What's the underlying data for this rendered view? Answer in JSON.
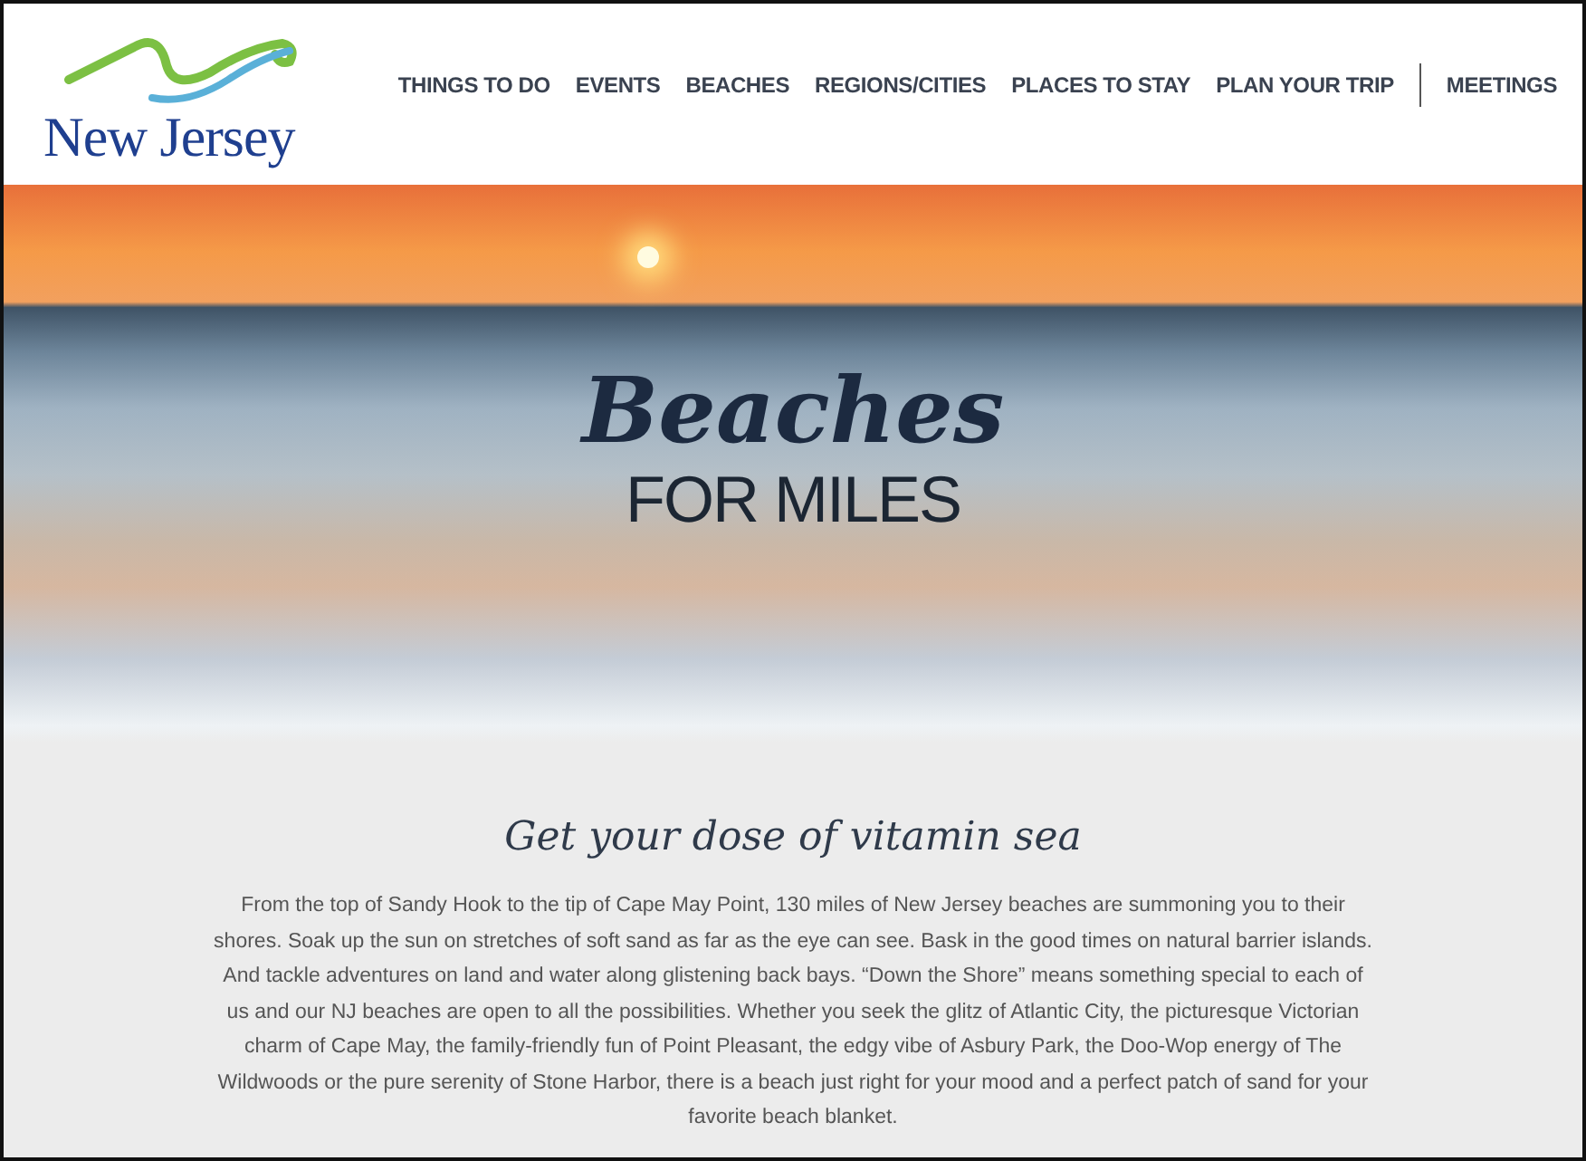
{
  "header": {
    "logo_text": "New Jersey",
    "nav": [
      {
        "label": "THINGS TO DO",
        "kind": "link"
      },
      {
        "label": "EVENTS",
        "kind": "link"
      },
      {
        "label": "BEACHES",
        "kind": "link"
      },
      {
        "label": "REGIONS/CITIES",
        "kind": "link"
      },
      {
        "label": "PLACES TO STAY",
        "kind": "link"
      },
      {
        "label": "PLAN YOUR TRIP",
        "kind": "link"
      },
      {
        "label": "MEETINGS",
        "kind": "separated"
      }
    ]
  },
  "hero": {
    "title": "Beaches",
    "subtitle": "FOR MILES"
  },
  "intro": {
    "heading": "Get your dose of vitamin sea",
    "text": "From the top of Sandy Hook to the tip of Cape May Point, 130 miles of New Jersey beaches are summoning you to their shores. Soak up the sun on stretches of soft sand as far as the eye can see. Bask in the good times on natural barrier islands. And tackle adventures on land and water along glistening back bays. “Down the Shore” means something special to each of us and our NJ beaches are open to all the possibilities. Whether you seek the glitz of Atlantic City, the picturesque Victorian charm of Cape May, the family-friendly fun of Point Pleasant, the edgy vibe of Asbury Park, the Doo-Wop energy of The Wildwoods or the pure serenity of Stone Harbor, there is a beach just right for your mood and a perfect patch of sand for your favorite beach blanket."
  }
}
